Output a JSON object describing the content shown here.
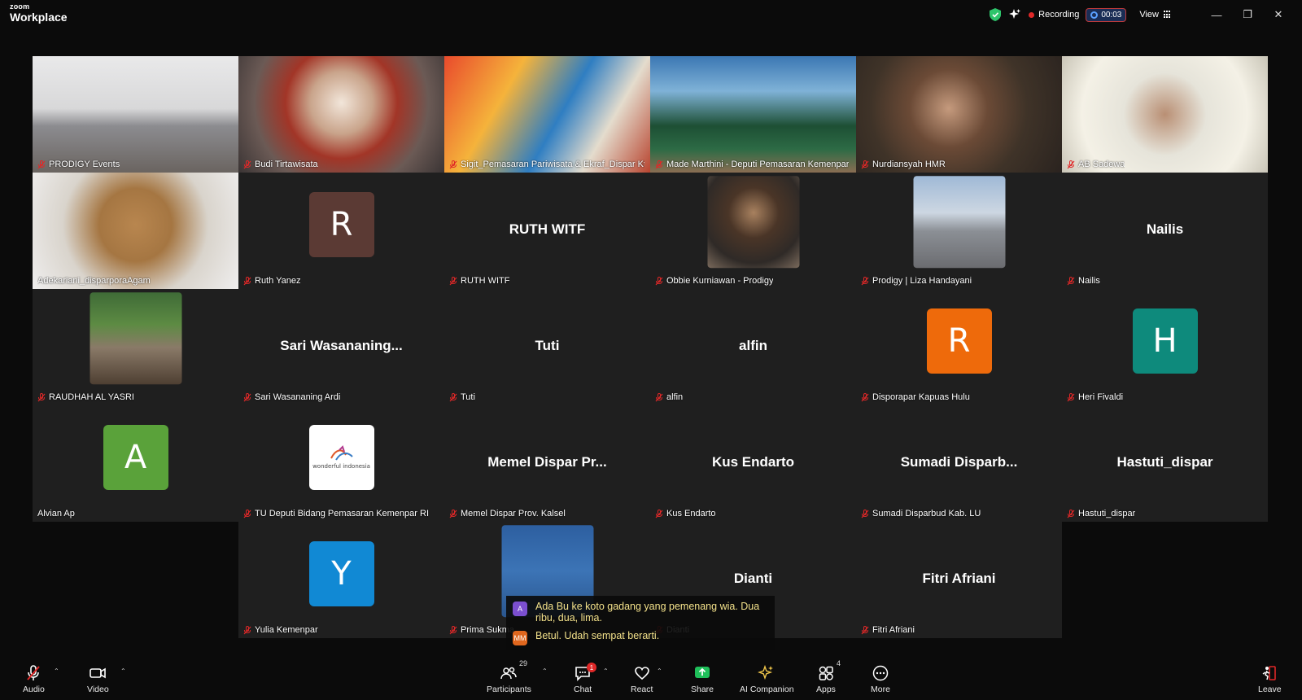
{
  "app": {
    "brand_small": "zoom",
    "brand_big": "Workplace"
  },
  "topbar": {
    "recording_label": "Recording",
    "timer": "00:03",
    "view_label": "View"
  },
  "colors": {
    "active_speaker": "#2ec56b",
    "recording_red": "#e02828",
    "share_green": "#1fbf5a"
  },
  "tiles": [
    {
      "name": "PRODIGY Events",
      "kind": "video"
    },
    {
      "name": "Budi Tirtawisata",
      "kind": "video"
    },
    {
      "name": "Sigit_Pemasaran Pariwisata & Ekraf_Dispar Kt...",
      "kind": "video"
    },
    {
      "name": "Made Marthini - Deputi Pemasaran Kemenpar",
      "kind": "video",
      "active": true
    },
    {
      "name": "Nurdiansyah HMR",
      "kind": "video"
    },
    {
      "name": "AB Sadewa",
      "kind": "video"
    },
    {
      "name": "Adekariani_disparporaAgam",
      "kind": "video"
    },
    {
      "name": "Ruth Yanez",
      "kind": "avatar",
      "initial": "R",
      "color": "#5b3a34"
    },
    {
      "name": "RUTH WITF",
      "kind": "text",
      "display": "RUTH WITF"
    },
    {
      "name": "Obbie Kurniawan - Prodigy",
      "kind": "photo"
    },
    {
      "name": "Prodigy | Liza Handayani",
      "kind": "photo"
    },
    {
      "name": "Nailis",
      "kind": "text",
      "display": "Nailis"
    },
    {
      "name": "RAUDHAH AL YASRI",
      "kind": "photo"
    },
    {
      "name": "Sari Wasananing Ardi",
      "kind": "text",
      "display": "Sari  Wasananing..."
    },
    {
      "name": "Tuti",
      "kind": "text",
      "display": "Tuti"
    },
    {
      "name": "alfin",
      "kind": "text",
      "display": "alfin"
    },
    {
      "name": "Disporapar Kapuas Hulu",
      "kind": "avatar",
      "initial": "R",
      "color": "#ee6a0b"
    },
    {
      "name": "Heri Fivaldi",
      "kind": "avatar",
      "initial": "H",
      "color": "#0e8a7c"
    },
    {
      "name": "Alvian Ap",
      "kind": "avatar",
      "initial": "A",
      "color": "#5aa23a"
    },
    {
      "name": "TU Deputi Bidang Pemasaran Kemenpar RI",
      "kind": "logo",
      "logo_text": "wonderful indonesia"
    },
    {
      "name": "Memel Dispar Prov. Kalsel",
      "kind": "text",
      "display": "Memel Dispar Pr..."
    },
    {
      "name": "Kus Endarto",
      "kind": "text",
      "display": "Kus Endarto"
    },
    {
      "name": "Sumadi Disparbud Kab. LU",
      "kind": "text",
      "display": "Sumadi  Disparb..."
    },
    {
      "name": "Hastuti_dispar",
      "kind": "text",
      "display": "Hastuti_dispar"
    },
    {
      "name": "Yulia Kemenpar",
      "kind": "avatar",
      "initial": "Y",
      "color": "#1189d4"
    },
    {
      "name": "Prima Sukma",
      "kind": "photo_blue"
    },
    {
      "name": "Dianti",
      "kind": "text",
      "display": "Dianti"
    },
    {
      "name": "Fitri Afriani",
      "kind": "text",
      "display": "Fitri Afriani"
    }
  ],
  "captions": [
    {
      "initials": "A",
      "color": "#7b4fd0",
      "text": "Ada Bu ke koto gadang yang pemenang wia. Dua ribu, dua, lima."
    },
    {
      "initials": "MM",
      "color": "#e0671e",
      "text": "Betul. Udah sempat berarti."
    }
  ],
  "toolbar": {
    "audio": "Audio",
    "video": "Video",
    "participants": "Participants",
    "participants_count": "29",
    "chat": "Chat",
    "chat_badge": "1",
    "react": "React",
    "share": "Share",
    "ai_companion": "AI Companion",
    "apps": "Apps",
    "apps_count": "4",
    "more": "More",
    "leave": "Leave"
  }
}
